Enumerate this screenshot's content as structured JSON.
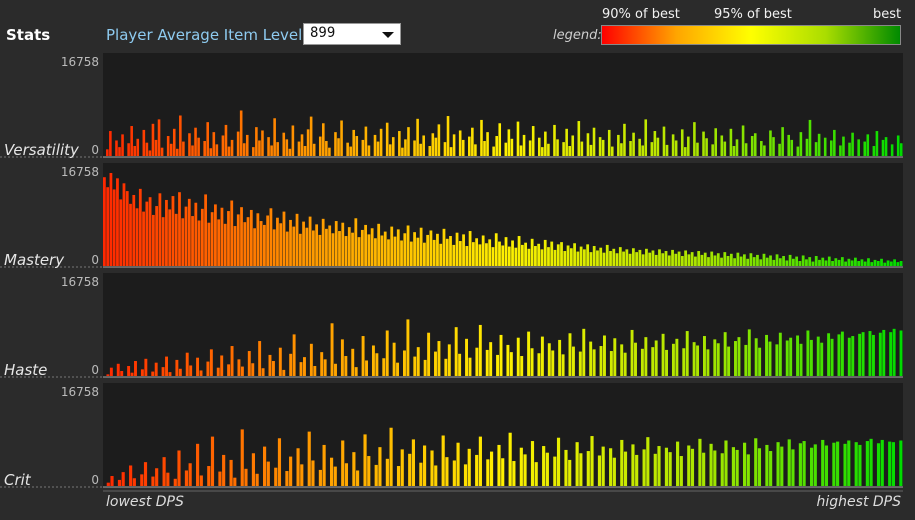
{
  "header": {
    "title": "Stats",
    "item_level_label": "Player Average Item Level:",
    "item_level_value": "899"
  },
  "legend": {
    "label": "legend:",
    "tick_90": "90% of best",
    "tick_95": "95% of best",
    "tick_best": "best"
  },
  "footer": {
    "left": "lowest DPS",
    "right": "highest DPS"
  },
  "chart_data": {
    "type": "bar",
    "x_axis": "players sorted from lowest DPS to highest DPS",
    "ymax_label": "16758",
    "ymin_label": "0",
    "ylim": [
      0,
      16758
    ],
    "bar_color_gradient": [
      "#ff0000",
      "#ffa500",
      "#ffff00",
      "#aadd00",
      "#00dd00"
    ],
    "panels": [
      {
        "label": "Versatility",
        "values": [
          0,
          1200,
          4500,
          0,
          2800,
          1600,
          3900,
          0,
          2300,
          5400,
          1800,
          3100,
          0,
          4700,
          2400,
          1000,
          5800,
          2900,
          6600,
          1500,
          0,
          3600,
          2200,
          4900,
          1300,
          7300,
          2600,
          0,
          4100,
          1900,
          5100,
          3300,
          0,
          2700,
          6100,
          1400,
          4300,
          2100,
          0,
          3700,
          5600,
          1700,
          2900,
          0,
          4400,
          8200,
          2300,
          3800,
          0,
          1600,
          5200,
          2800,
          4600,
          0,
          3400,
          1900,
          6800,
          2500,
          0,
          4200,
          3000,
          1300,
          5500,
          0,
          2600,
          3900,
          1800,
          4800,
          7100,
          2200,
          0,
          3500,
          5900,
          2700,
          1500,
          0,
          4300,
          3200,
          6400,
          0,
          2400,
          1700,
          4700,
          3600,
          0,
          2900,
          5300,
          1900,
          0,
          3800,
          2600,
          4900,
          0,
          6000,
          2100,
          3400,
          0,
          4500,
          1500,
          3000,
          5200,
          0,
          2800,
          6700,
          2200,
          3700,
          0,
          1800,
          4100,
          3300,
          5700,
          0,
          2500,
          7200,
          1600,
          3900,
          0,
          4600,
          2900,
          0,
          3500,
          5100,
          2100,
          0,
          6500,
          2700,
          4300,
          0,
          1700,
          3600,
          5900,
          0,
          2400,
          4800,
          3100,
          0,
          6200,
          1900,
          3800,
          0,
          2800,
          5400,
          0,
          3300,
          1600,
          4400,
          2200,
          0,
          5600,
          3000,
          0,
          2500,
          4900,
          1800,
          3700,
          0,
          6300,
          2600,
          0,
          4100,
          2000,
          5100,
          0,
          3400,
          2900,
          0,
          4700,
          1700,
          0,
          3800,
          2300,
          5800,
          0,
          2700,
          4200,
          0,
          3100,
          1900,
          6600,
          0,
          2500,
          4500,
          3300,
          0,
          5300,
          2000,
          0,
          3900,
          2800,
          0,
          4800,
          1600,
          3500,
          0,
          6100,
          2400,
          0,
          4400,
          3200,
          0,
          2100,
          5000,
          0,
          3700,
          2600,
          0,
          4900,
          1800,
          3000,
          0,
          5500,
          2300,
          0,
          3600,
          4100,
          0,
          2700,
          1900,
          0,
          4600,
          3400,
          0,
          2200,
          5200,
          0,
          3800,
          2900,
          0,
          1700,
          4300,
          0,
          3100,
          6500,
          0,
          2500,
          4000,
          0,
          3300,
          0,
          2800,
          4700,
          0,
          1900,
          3500,
          0,
          2400,
          4200,
          0,
          3000,
          0,
          2600,
          3900,
          0,
          1800,
          4500,
          0,
          2900,
          3400,
          0,
          2100,
          0,
          3700,
          2300
        ],
        "value_scale": 1.0
      },
      {
        "label": "Mastery",
        "values": [
          16000,
          14200,
          16758,
          13800,
          15800,
          12000,
          14900,
          13500,
          11200,
          12800,
          10400,
          13900,
          9800,
          11600,
          12400,
          9200,
          10800,
          13100,
          8800,
          11900,
          10200,
          12600,
          9400,
          13300,
          8600,
          10700,
          12100,
          9000,
          11400,
          8200,
          10300,
          12900,
          7800,
          9700,
          11100,
          8400,
          10500,
          7600,
          9900,
          11800,
          7200,
          9300,
          10600,
          7900,
          8800,
          10100,
          6800,
          9500,
          8100,
          7400,
          9100,
          10400,
          6600,
          8700,
          7700,
          9800,
          6200,
          8300,
          7100,
          9400,
          5800,
          8000,
          6900,
          8900,
          6400,
          7500,
          5600,
          8500,
          6700,
          7300,
          5900,
          8100,
          6300,
          7800,
          5400,
          7000,
          6000,
          8600,
          5200,
          6500,
          7400,
          5700,
          6800,
          5000,
          7600,
          5500,
          6200,
          4800,
          7100,
          5300,
          6600,
          4600,
          5900,
          7300,
          4400,
          6100,
          5100,
          6900,
          4200,
          5600,
          6400,
          4700,
          5800,
          4000,
          6700,
          4900,
          5400,
          3800,
          6000,
          4500,
          5700,
          3600,
          6300,
          4300,
          5000,
          3900,
          5500,
          4100,
          4800,
          3400,
          5900,
          4400,
          3700,
          5200,
          3500,
          4600,
          3300,
          5400,
          3800,
          4200,
          3100,
          4900,
          3600,
          4000,
          3000,
          4700,
          3400,
          4400,
          2900,
          3900,
          4300,
          2700,
          3700,
          3200,
          4100,
          2600,
          3500,
          3000,
          3900,
          2500,
          3600,
          2800,
          3300,
          2400,
          3800,
          2700,
          3100,
          2300,
          3400,
          2600,
          3000,
          2200,
          3200,
          2500,
          2900,
          2100,
          3100,
          2400,
          2800,
          2000,
          3000,
          2300,
          2700,
          1900,
          2900,
          2200,
          2600,
          1800,
          2800,
          2100,
          2500,
          1700,
          2700,
          2000,
          2400,
          1600,
          2600,
          1900,
          2300,
          1500,
          2500,
          1800,
          2200,
          1400,
          2400,
          1700,
          2100,
          1300,
          2300,
          1600,
          2000,
          1200,
          2200,
          1500,
          1900,
          1100,
          2100,
          1400,
          1800,
          1000,
          2000,
          1300,
          1700,
          900,
          1900,
          1200,
          1600,
          800,
          1800,
          1100,
          1500,
          1000,
          1700,
          900,
          1400,
          1100,
          1600,
          800,
          1300,
          1000,
          1500,
          900,
          1200,
          800,
          1400,
          700,
          1100,
          900,
          1300,
          600,
          1000,
          800,
          1200,
          700,
          900
        ],
        "value_scale": 1.0
      },
      {
        "label": "Haste",
        "values": [
          0,
          300,
          1500,
          0,
          2200,
          900,
          0,
          1800,
          600,
          2700,
          0,
          1200,
          3100,
          0,
          800,
          2400,
          0,
          1600,
          3500,
          700,
          0,
          2900,
          1300,
          0,
          4200,
          1900,
          0,
          3300,
          1000,
          0,
          2600,
          4800,
          0,
          1500,
          3700,
          0,
          2100,
          5400,
          0,
          3000,
          1700,
          0,
          4500,
          2300,
          0,
          6300,
          1400,
          0,
          3800,
          2700,
          0,
          5100,
          1100,
          0,
          4000,
          7500,
          0,
          2500,
          3400,
          0,
          5800,
          1800,
          0,
          4300,
          3000,
          0,
          9500,
          2200,
          0,
          6600,
          3600,
          0,
          4900,
          1600,
          0,
          7200,
          2800,
          0,
          5500,
          4100,
          0,
          3200,
          8200,
          0,
          6000,
          2400,
          0,
          4600,
          10200,
          0,
          3500,
          5200,
          0,
          2900,
          7800,
          0,
          4400,
          6300,
          0,
          3100,
          5700,
          0,
          8800,
          4000,
          0,
          6700,
          3300,
          0,
          5100,
          9200,
          0,
          4700,
          6100,
          0,
          3800,
          7400,
          0,
          5600,
          4300,
          0,
          6900,
          3600,
          0,
          8000,
          5000,
          0,
          4100,
          7100,
          0,
          5900,
          4600,
          0,
          6500,
          3900,
          0,
          7700,
          5300,
          0,
          4400,
          8500,
          0,
          6200,
          4800,
          0,
          5400,
          7300,
          0,
          4500,
          6800,
          0,
          5700,
          4200,
          0,
          8300,
          6000,
          0,
          4900,
          7000,
          0,
          5200,
          6400,
          0,
          7600,
          4700,
          0,
          5800,
          6700,
          0,
          5000,
          8100,
          0,
          6100,
          5500,
          0,
          7200,
          4800,
          0,
          6600,
          5900,
          0,
          7900,
          5300,
          0,
          6300,
          7000,
          0,
          5600,
          8400,
          0,
          6800,
          5100,
          0,
          7400,
          6200,
          0,
          5700,
          7800,
          0,
          6400,
          6900,
          0,
          7300,
          5800,
          0,
          8200,
          6500,
          0,
          7100,
          6000,
          0,
          7700,
          6700,
          0,
          7500,
          8000,
          0,
          6900,
          7200,
          0,
          7600,
          7900,
          0,
          8100,
          7400,
          0,
          7800,
          8300,
          0,
          7900,
          8500,
          0,
          8200
        ],
        "value_scale": 1.0
      },
      {
        "label": "Crit",
        "values": [
          0,
          600,
          1800,
          0,
          1100,
          2500,
          0,
          3700,
          1400,
          0,
          2100,
          4300,
          0,
          1700,
          3200,
          0,
          5200,
          2400,
          0,
          1300,
          6400,
          0,
          2800,
          4100,
          0,
          7600,
          1900,
          0,
          3600,
          8900,
          0,
          2600,
          5600,
          0,
          4700,
          1500,
          0,
          10200,
          3100,
          0,
          5900,
          2200,
          0,
          7100,
          4400,
          0,
          3300,
          8600,
          0,
          2700,
          5300,
          0,
          6800,
          3900,
          0,
          9800,
          4600,
          0,
          2900,
          7400,
          0,
          5100,
          3500,
          0,
          8200,
          4100,
          0,
          6100,
          2800,
          0,
          9300,
          5400,
          0,
          3800,
          7000,
          0,
          4900,
          10500,
          0,
          3600,
          6600,
          0,
          5800,
          8400,
          0,
          4200,
          7300,
          0,
          6400,
          3700,
          0,
          9100,
          5200,
          0,
          4600,
          7800,
          0,
          3900,
          6700,
          0,
          5600,
          8900,
          0,
          4800,
          6200,
          0,
          7400,
          5000,
          0,
          9600,
          4500,
          0,
          6900,
          5700,
          0,
          8100,
          4300,
          0,
          7200,
          6000,
          0,
          5300,
          8700,
          0,
          6500,
          4700,
          0,
          7900,
          5900,
          0,
          6300,
          9000,
          0,
          5500,
          7100,
          0,
          6800,
          5100,
          0,
          8300,
          6200,
          0,
          7500,
          5600,
          0,
          6600,
          8800,
          0,
          5800,
          7200,
          0,
          6900,
          6100,
          0,
          8000,
          5400,
          0,
          7300,
          6700,
          0,
          8500,
          6000,
          0,
          7600,
          6400,
          0,
          5900,
          8200,
          0,
          7000,
          6500,
          0,
          7800,
          5700,
          0,
          8600,
          6800,
          0,
          7400,
          6300,
          0,
          7900,
          7100,
          0,
          8400,
          6600,
          0,
          7700,
          8100,
          0,
          6900,
          7500,
          0,
          8300,
          7300,
          0,
          7800,
          8000,
          0,
          7600,
          8200,
          0,
          7900,
          7400,
          0,
          8100,
          8500,
          0,
          7700,
          8300,
          0,
          8000,
          7900,
          0,
          8200
        ],
        "value_scale": 1.0
      }
    ]
  }
}
